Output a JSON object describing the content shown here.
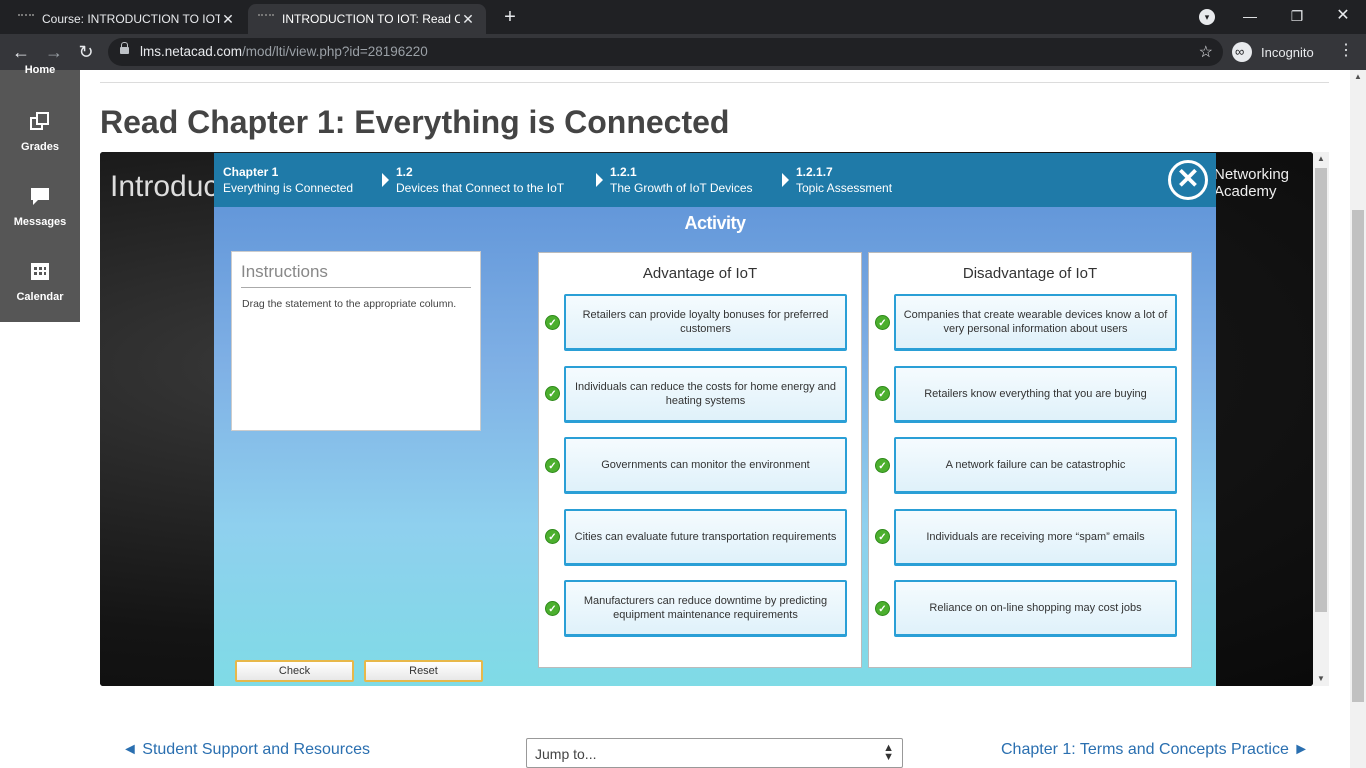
{
  "browser": {
    "tabs": [
      {
        "title": "Course: INTRODUCTION TO IOT",
        "active": false
      },
      {
        "title": "INTRODUCTION TO IOT: Read Ch",
        "active": true
      }
    ],
    "url_host": "lms.netacad.com",
    "url_path": "/mod/lti/view.php?id=28196220",
    "profile_label": "Incognito"
  },
  "sidebar": {
    "items": [
      {
        "label": "Home",
        "icon": "home-icon"
      },
      {
        "label": "Grades",
        "icon": "grades-icon"
      },
      {
        "label": "Messages",
        "icon": "messages-icon"
      },
      {
        "label": "Calendar",
        "icon": "calendar-icon"
      }
    ]
  },
  "page": {
    "title": "Read Chapter 1: Everything is Connected",
    "embed_intro_text": "Introduc",
    "embed_brand_text_1": "Networking",
    "embed_brand_text_2": "Academy"
  },
  "activity": {
    "breadcrumbs": [
      {
        "num": "Chapter 1",
        "label": "Everything is Connected"
      },
      {
        "num": "1.2",
        "label": "Devices that Connect to the IoT"
      },
      {
        "num": "1.2.1",
        "label": "The Growth of IoT Devices"
      },
      {
        "num": "1.2.1.7",
        "label": "Topic Assessment"
      }
    ],
    "title": "Activity",
    "instructions_title": "Instructions",
    "instructions_body": "Drag the statement to the appropriate column.",
    "advantage_title": "Advantage of IoT",
    "disadvantage_title": "Disadvantage of IoT",
    "advantages": [
      "Retailers can provide loyalty bonuses for preferred customers",
      "Individuals can reduce the costs for home energy and heating systems",
      "Governments can monitor the environment",
      "Cities can evaluate future transportation requirements",
      "Manufacturers can reduce downtime by predicting equipment maintenance requirements"
    ],
    "disadvantages": [
      "Companies that create wearable devices know a lot of very personal information about users",
      "Retailers know everything that you are buying",
      "A network failure can be catastrophic",
      "Individuals are receiving more “spam” emails",
      "Reliance on on-line shopping may cost jobs"
    ],
    "check_label": "Check",
    "reset_label": "Reset"
  },
  "footer_nav": {
    "prev_label": "◄ Student Support and Resources",
    "jump_label": "Jump to...",
    "next_label": "Chapter 1: Terms and Concepts Practice ►"
  }
}
